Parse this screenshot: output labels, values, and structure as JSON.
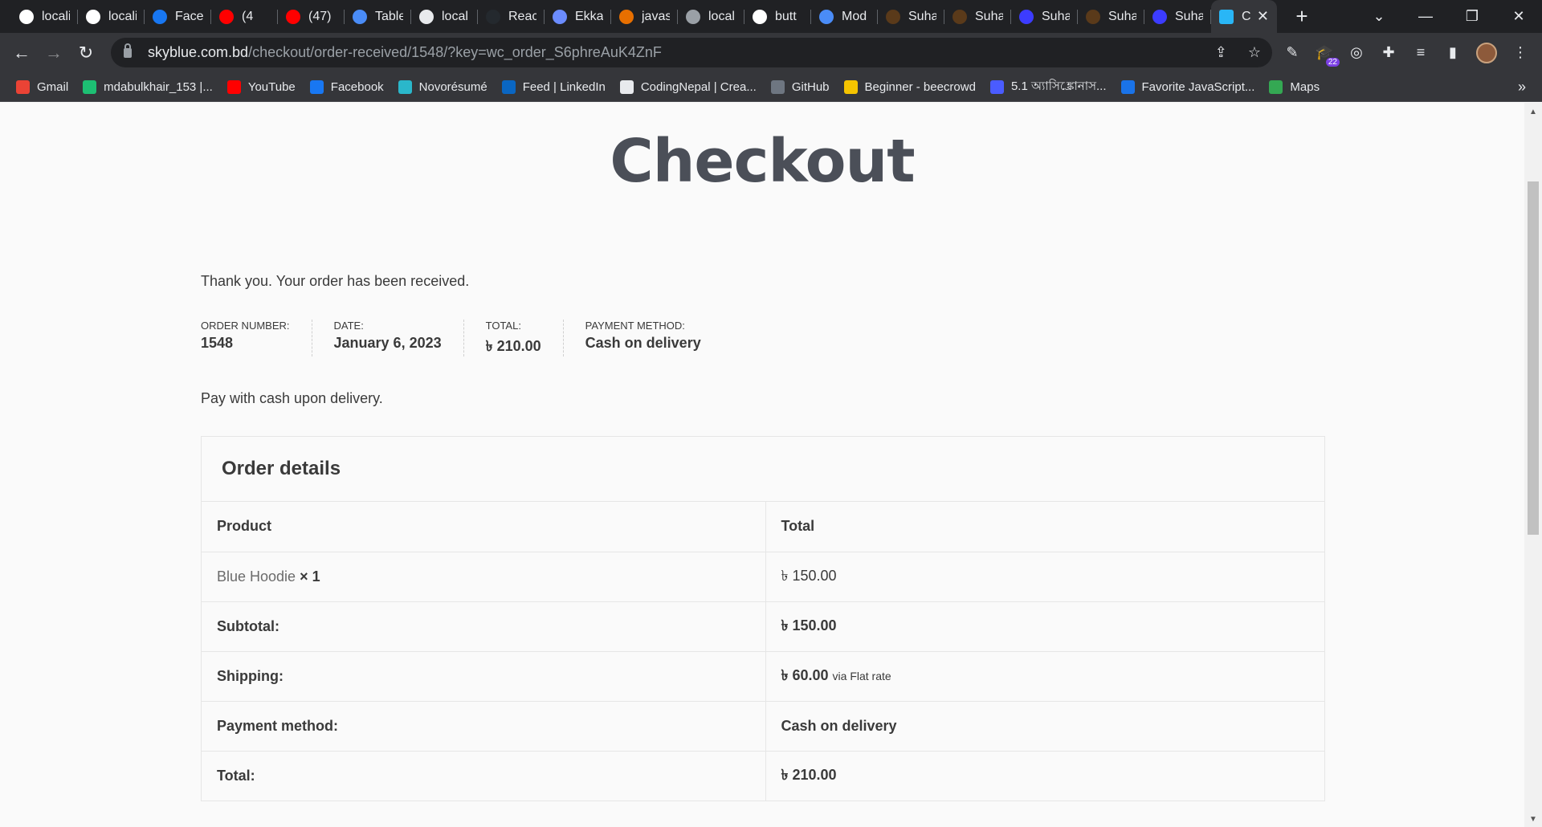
{
  "browser": {
    "tabs": [
      {
        "title": "locali",
        "icon": "vercel-icon",
        "color": "#ffffff"
      },
      {
        "title": "locali",
        "icon": "vercel-icon",
        "color": "#ffffff"
      },
      {
        "title": "Facel",
        "icon": "facebook-icon",
        "color": "#1877f2"
      },
      {
        "title": "(4",
        "icon": "youtube-icon",
        "color": "#ff0000"
      },
      {
        "title": "(47)",
        "icon": "youtube-icon",
        "color": "#ff0000"
      },
      {
        "title": "Table",
        "icon": "diamond-icon",
        "color": "#4a8cf7"
      },
      {
        "title": "local",
        "icon": "globe-icon",
        "color": "#e8eaed"
      },
      {
        "title": "Reac",
        "icon": "github-icon",
        "color": "#24292e"
      },
      {
        "title": "Ekka",
        "icon": "ekka-icon",
        "color": "#6b8cff"
      },
      {
        "title": "javas",
        "icon": "java-icon",
        "color": "#e76f00"
      },
      {
        "title": "local",
        "icon": "globe-icon",
        "color": "#9aa0a6"
      },
      {
        "title": "butt",
        "icon": "google-icon",
        "color": "#ffffff"
      },
      {
        "title": "Mod",
        "icon": "diamond-icon",
        "color": "#4a8cf7"
      },
      {
        "title": "Suha",
        "icon": "suha-icon",
        "color": "#5a3a1a"
      },
      {
        "title": "Suha",
        "icon": "suha-icon",
        "color": "#5a3a1a"
      },
      {
        "title": "Suha",
        "icon": "firefox-icon",
        "color": "#3c3cff"
      },
      {
        "title": "Suha",
        "icon": "suha-icon",
        "color": "#5a3a1a"
      },
      {
        "title": "Suha",
        "icon": "firefox-icon",
        "color": "#3c3cff"
      }
    ],
    "active_tab": {
      "title": "C",
      "icon": "skyblue-icon",
      "color": "#29b6f6"
    },
    "url_host": "skyblue.com.bd",
    "url_path": "/checkout/order-received/1548/?key=wc_order_S6phreAuK4ZnF",
    "extension_badge": "22",
    "bookmarks": [
      {
        "label": "Gmail",
        "icon": "gmail-icon",
        "color": "#ea4335"
      },
      {
        "label": "mdabulkhair_153 |...",
        "icon": "fiverr-icon",
        "color": "#1dbf73"
      },
      {
        "label": "YouTube",
        "icon": "youtube-icon",
        "color": "#ff0000"
      },
      {
        "label": "Facebook",
        "icon": "facebook-icon",
        "color": "#1877f2"
      },
      {
        "label": "Novorésumé",
        "icon": "novoresume-icon",
        "color": "#2ab7ca"
      },
      {
        "label": "Feed | LinkedIn",
        "icon": "linkedin-icon",
        "color": "#0a66c2"
      },
      {
        "label": "CodingNepal | Crea...",
        "icon": "globe-icon",
        "color": "#e8eaed"
      },
      {
        "label": "GitHub",
        "icon": "github-icon",
        "color": "#6e7681"
      },
      {
        "label": "Beginner - beecrowd",
        "icon": "beecrowd-icon",
        "color": "#f5c400"
      },
      {
        "label": "5.1 অ্যাসিঙ্ক্রোনাস...",
        "icon": "bookmark-icon",
        "color": "#4a5cff"
      },
      {
        "label": "Favorite JavaScript...",
        "icon": "info-icon",
        "color": "#1a73e8"
      },
      {
        "label": "Maps",
        "icon": "maps-icon",
        "color": "#34a853"
      }
    ]
  },
  "page": {
    "title": "Checkout",
    "thanks": "Thank you. Your order has been received.",
    "overview": [
      {
        "label": "Order number:",
        "value": "1548"
      },
      {
        "label": "Date:",
        "value": "January 6, 2023"
      },
      {
        "label": "Total:",
        "value": "৳ 210.00"
      },
      {
        "label": "Payment method:",
        "value": "Cash on delivery"
      }
    ],
    "pay_note": "Pay with cash upon delivery.",
    "details": {
      "heading": "Order details",
      "header_product": "Product",
      "header_total": "Total",
      "item_name": "Blue Hoodie",
      "item_qty": "× 1",
      "item_total": "৳ 150.00",
      "subtotal_label": "Subtotal:",
      "subtotal_value": "৳ 150.00",
      "shipping_label": "Shipping:",
      "shipping_value": "৳ 60.00",
      "shipping_via": "via Flat rate",
      "payment_label": "Payment method:",
      "payment_value": "Cash on delivery",
      "total_label": "Total:",
      "total_value": "৳ 210.00"
    }
  }
}
